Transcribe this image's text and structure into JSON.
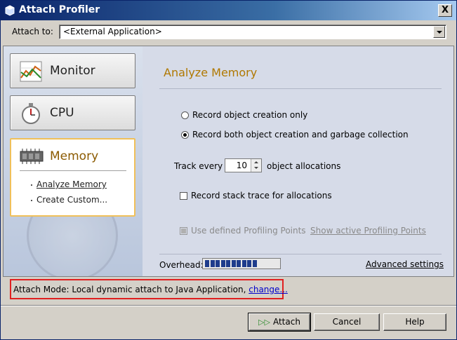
{
  "window": {
    "title": "Attach Profiler",
    "close_label": "X"
  },
  "attach": {
    "label": "Attach to:",
    "value": "<External Application>"
  },
  "sidebar": {
    "items": [
      {
        "label": "Monitor",
        "icon": "monitor-chart-icon"
      },
      {
        "label": "CPU",
        "icon": "stopwatch-icon"
      },
      {
        "label": "Memory",
        "icon": "memory-chip-icon",
        "selected": true
      }
    ],
    "memory_subitems": [
      "Analyze Memory",
      "Create Custom..."
    ]
  },
  "content": {
    "title": "Analyze Memory",
    "radio_creation_only": "Record object creation only",
    "radio_creation_gc": "Record both object creation and garbage collection",
    "track_prefix": "Track every",
    "track_value": "10",
    "track_suffix": "object allocations",
    "stack_trace_label": "Record stack trace for allocations",
    "profiling_points_label": "Use defined Profiling Points",
    "show_points_link": "Show active Profiling Points",
    "overhead_label": "Overhead:",
    "overhead_level": 0.7,
    "advanced_link": "Advanced settings"
  },
  "mode": {
    "label": "Attach Mode:",
    "value": "Local dynamic attach to Java Application,",
    "change_link": "change..."
  },
  "buttons": {
    "attach": "Attach",
    "cancel": "Cancel",
    "help": "Help"
  },
  "colors": {
    "accent_title": "#b07800",
    "highlight_border": "#f0c05a",
    "annotation_red": "#e02020"
  }
}
